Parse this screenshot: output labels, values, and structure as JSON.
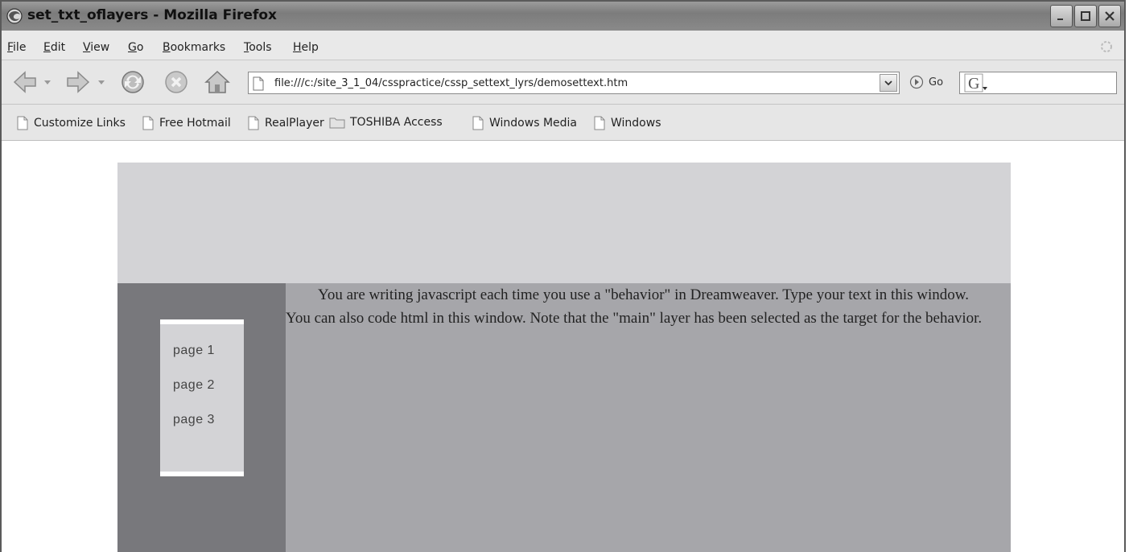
{
  "window": {
    "title": "set_txt_oflayers - Mozilla Firefox"
  },
  "menu": {
    "items": [
      "File",
      "Edit",
      "View",
      "Go",
      "Bookmarks",
      "Tools",
      "Help"
    ]
  },
  "toolbar": {
    "url": "file:///c:/site_3_1_04/csspractice/cssp_settext_lyrs/demosettext.htm",
    "go_label": "Go"
  },
  "bookmarks": {
    "items": [
      {
        "label": "Customize Links",
        "icon": "page-icon"
      },
      {
        "label": "Free Hotmail",
        "icon": "page-icon"
      },
      {
        "label": "RealPlayer",
        "icon": "page-icon"
      },
      {
        "label": "TOSHIBA Access",
        "icon": "folder-icon"
      },
      {
        "label": "Windows Media",
        "icon": "page-icon"
      },
      {
        "label": "Windows",
        "icon": "page-icon"
      }
    ]
  },
  "page": {
    "nav_links": [
      "page 1",
      "page 2",
      "page 3"
    ],
    "main_text": "You are writing javascript each time you use a \"behavior\" in Dreamweaver. Type your text in this window. You can also code html in this window. Note that the \"main\" layer has been selected as the target for the behavior.",
    "colors": {
      "banner": "#d3d3d6",
      "sidebar": "#78787c",
      "main": "#a6a6aa"
    }
  }
}
